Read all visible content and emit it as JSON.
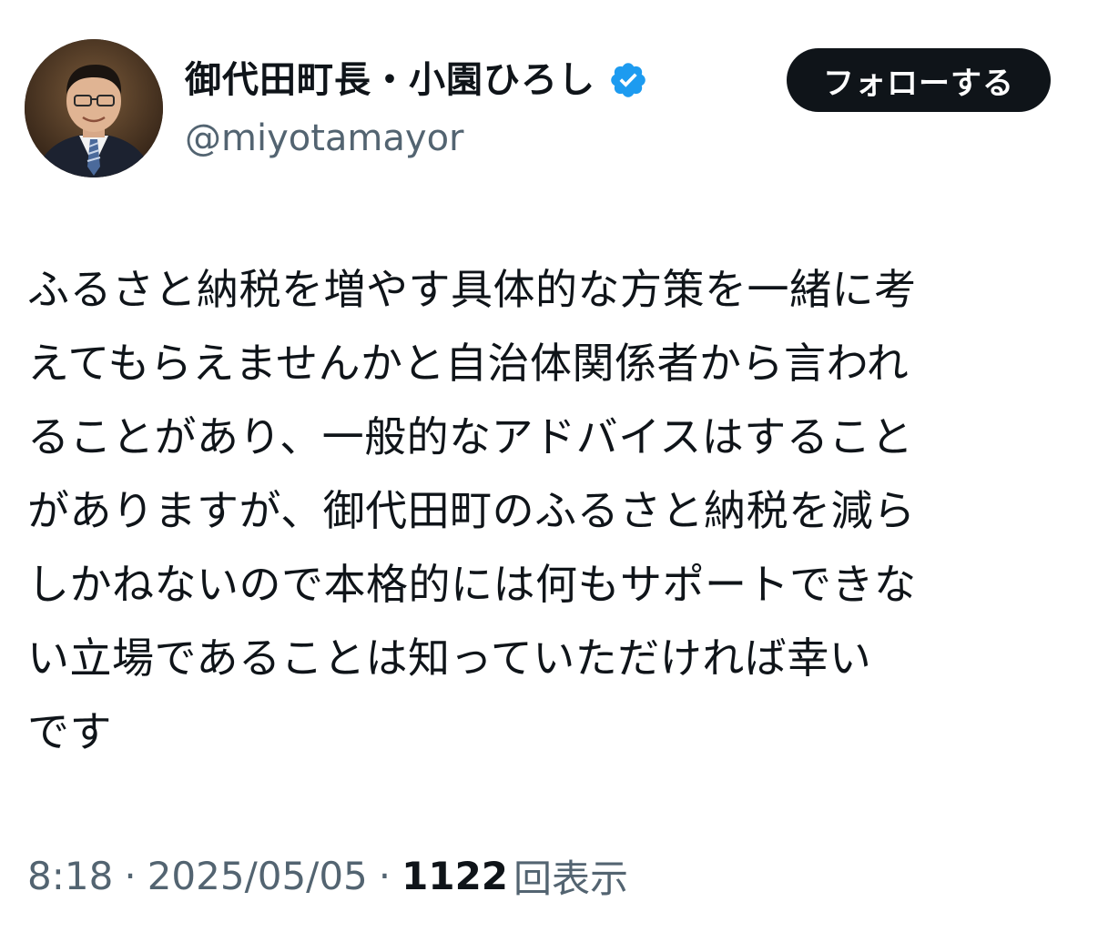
{
  "profile": {
    "display_name": "御代田町長・小園ひろし",
    "handle": "@miyotamayor",
    "verified_icon": "verified-badge-icon",
    "accent_color": "#1d9bf0"
  },
  "follow_button": {
    "label": "フォローする"
  },
  "tweet": {
    "lines": "ふるさと納税を増やす具体的な方策を一緒に考\nえてもらえませんかと自治体関係者から言われ\nることがあり、一般的なアドバイスはすること\nがありますが、御代田町のふるさと納税を減ら\nしかねないので本格的には何もサポートできな\nい立場であることは知っていただければ幸い\nです"
  },
  "meta": {
    "time": "8:18",
    "separator": "·",
    "date": "2025/05/05",
    "views_count": "1122",
    "views_label": "回表示"
  }
}
